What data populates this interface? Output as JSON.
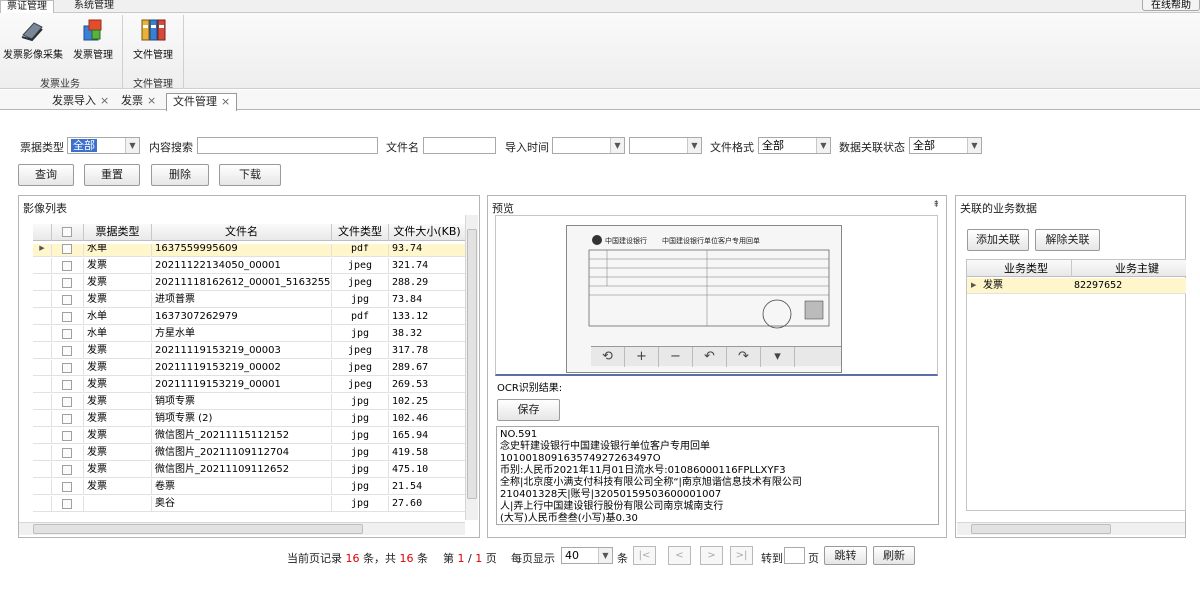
{
  "menu": {
    "tabs": [
      "票证管理",
      "系统管理"
    ],
    "online_help": "在线帮助"
  },
  "ribbon": {
    "buttons": [
      "发票影像采集",
      "发票管理",
      "文件管理"
    ],
    "groups": [
      "发票业务",
      "文件管理"
    ]
  },
  "doc_tabs": [
    {
      "label": "发票导入",
      "close": "×"
    },
    {
      "label": "发票",
      "close": "×"
    },
    {
      "label": "文件管理",
      "close": "×"
    }
  ],
  "filters": {
    "type_label": "票据类型",
    "type_value": "全部",
    "content_label": "内容搜索",
    "content_value": "",
    "filename_label": "文件名",
    "filename_value": "",
    "import_time_label": "导入时间",
    "format_label": "文件格式",
    "format_value": "全部",
    "link_label": "数据关联状态",
    "link_value": "全部"
  },
  "actions": {
    "query": "查询",
    "reset": "重置",
    "delete": "删除",
    "download": "下载"
  },
  "image_list": {
    "title": "影像列表",
    "columns": [
      "票据类型",
      "文件名",
      "文件类型",
      "文件大小(KB)"
    ],
    "rows": [
      [
        "水单",
        "1637559995609",
        "pdf",
        "93.74"
      ],
      [
        "发票",
        "20211122134050_00001",
        "jpeg",
        "321.74"
      ],
      [
        "发票",
        "20211118162612_00001_5163255…",
        "jpeg",
        "288.29"
      ],
      [
        "发票",
        "进项普票",
        "jpg",
        "73.84"
      ],
      [
        "水单",
        "1637307262979",
        "pdf",
        "133.12"
      ],
      [
        "水单",
        "方星水单",
        "jpg",
        "38.32"
      ],
      [
        "发票",
        "20211119153219_00003",
        "jpeg",
        "317.78"
      ],
      [
        "发票",
        "20211119153219_00002",
        "jpeg",
        "289.67"
      ],
      [
        "发票",
        "20211119153219_00001",
        "jpeg",
        "269.53"
      ],
      [
        "发票",
        "销项专票",
        "jpg",
        "102.25"
      ],
      [
        "发票",
        "销项专票 (2)",
        "jpg",
        "102.46"
      ],
      [
        "发票",
        "微信图片_20211115112152",
        "jpg",
        "165.94"
      ],
      [
        "发票",
        "微信图片_20211109112704",
        "jpg",
        "419.58"
      ],
      [
        "发票",
        "微信图片_20211109112652",
        "jpg",
        "475.10"
      ],
      [
        "发票",
        "卷票",
        "jpg",
        "21.54"
      ],
      [
        "",
        "奥谷",
        "jpg",
        "27.60"
      ]
    ]
  },
  "preview": {
    "title": "预览",
    "receipt_bank": "中国建设银行",
    "receipt_title": "中国建设银行单位客户专用回单",
    "ocr_label": "OCR识别结果:",
    "save": "保存",
    "ocr_lines": [
      "NO.591",
      "念史轩建设银行中国建设银行单位客户专用回单",
      "101001809163574927263497O",
      "币别:人民币2021年11月01日流水号:01086000116FPLLXYF3",
      "全称|北京度小满支付科技有限公司全称“|南京旭谐信息技术有限公司",
      "210401328天|账号|32050159503600001007",
      "人|弄上行中国建设银行股份有限公司南京城南支行",
      "(大写)人民币叁叁(小写)基0.30"
    ]
  },
  "linked": {
    "title": "关联的业务数据",
    "add": "添加关联",
    "remove": "解除关联",
    "columns": [
      "业务类型",
      "业务主键"
    ],
    "rows": [
      [
        "发票",
        "82297652"
      ]
    ]
  },
  "pager": {
    "prefix": "当前页记录",
    "page_count": "16",
    "mid": "条，共",
    "total": "16",
    "suffix": "条",
    "page_prefix": "第",
    "page_current": "1",
    "page_sep": "/",
    "page_total": "1",
    "page_suffix": "页",
    "per_page_label": "每页显示",
    "per_page": "40",
    "per_page_unit": "条",
    "goto_label": "转到",
    "goto_value": "",
    "goto_unit": "页",
    "jump": "跳转",
    "refresh": "刷新"
  }
}
